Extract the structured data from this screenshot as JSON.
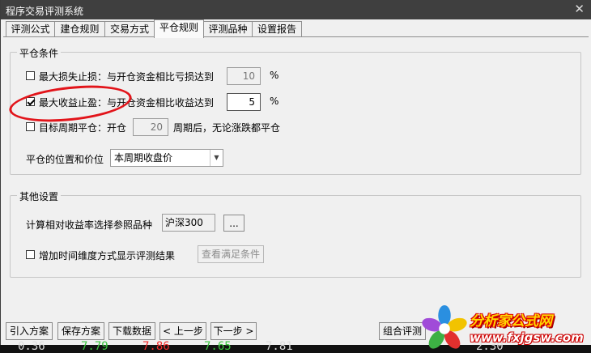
{
  "window": {
    "title": "程序交易评测系统",
    "close_glyph": "✕"
  },
  "tabs": [
    {
      "label": "评测公式",
      "active": false
    },
    {
      "label": "建仓规则",
      "active": false
    },
    {
      "label": "交易方式",
      "active": false
    },
    {
      "label": "平仓规则",
      "active": true
    },
    {
      "label": "评测品种",
      "active": false
    },
    {
      "label": "设置报告",
      "active": false
    }
  ],
  "close_conditions": {
    "title": "平仓条件",
    "stop_loss": {
      "label": "最大损失止损：与开仓资金相比亏损达到",
      "checked": false,
      "value": "10",
      "unit": "%"
    },
    "take_profit": {
      "label": "最大收益止盈：与开仓资金相比收益达到",
      "checked": true,
      "value": "5",
      "unit": "%"
    },
    "target_period": {
      "label": "目标周期平仓：开仓",
      "checked": false,
      "value": "20",
      "suffix": "周期后，无论涨跌都平仓"
    },
    "position_price": {
      "label": "平仓的位置和价位",
      "selected": "本周期收盘价"
    }
  },
  "other_settings": {
    "title": "其他设置",
    "benchmark": {
      "label": "计算相对收益率选择参照品种",
      "value": "沪深300",
      "browse_label": "..."
    },
    "time_dimension": {
      "label": "增加时间维度方式显示评测结果",
      "checked": false,
      "view_button": "查看满足条件"
    }
  },
  "footer": {
    "import_label": "引入方案",
    "save_label": "保存方案",
    "download_label": "下载数据",
    "prev_label": "< 上一步",
    "next_label": "下一步 >",
    "combo_label": "组合评测"
  },
  "background_strip": [
    "0.36",
    "7.79",
    "7.86",
    "7.65",
    "7.81",
    "2.30"
  ],
  "watermark": {
    "name": "分析家公式网",
    "url": "www.fxjgsw.com"
  },
  "colors": {
    "annotation": "#e2141a",
    "watermark_text": "#ffd800",
    "watermark_outline": "#d00000"
  }
}
